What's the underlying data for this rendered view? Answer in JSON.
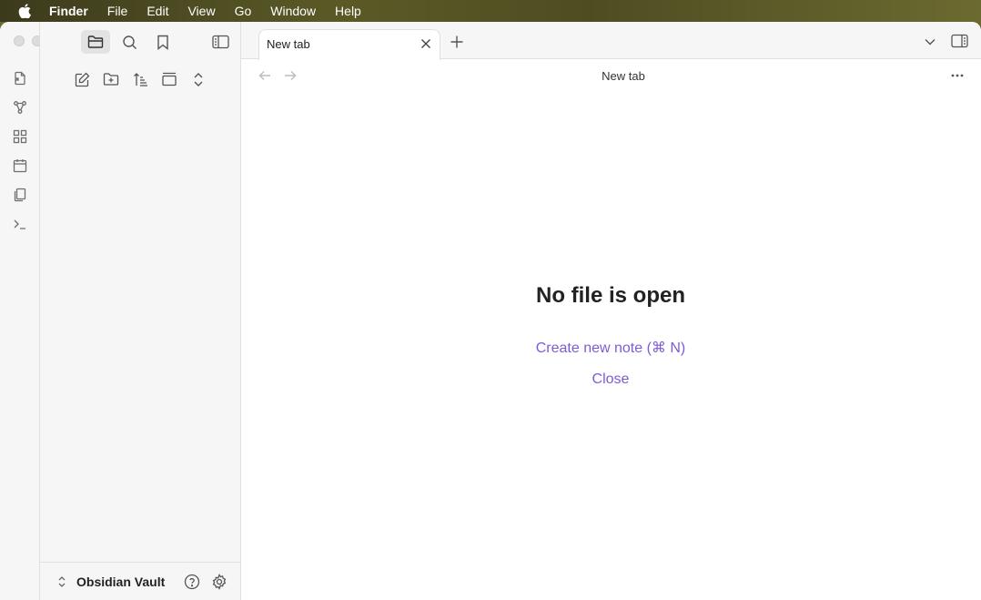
{
  "menubar": {
    "app_name": "Finder",
    "items": [
      "File",
      "Edit",
      "View",
      "Go",
      "Window",
      "Help"
    ]
  },
  "ribbon": {
    "icons": [
      "open-quick-switcher-icon",
      "graph-view-icon",
      "canvas-icon",
      "daily-note-icon",
      "templates-icon",
      "command-palette-icon"
    ]
  },
  "sidebar": {
    "tabs": [
      "files-icon",
      "search-icon",
      "bookmarks-icon"
    ],
    "actions": [
      "new-note-icon",
      "new-folder-icon",
      "sort-icon",
      "collapse-all-icon",
      "expand-icon"
    ],
    "vault_name": "Obsidian Vault"
  },
  "tabbar": {
    "tabs": [
      {
        "title": "New tab"
      }
    ]
  },
  "view": {
    "title": "New tab"
  },
  "empty_state": {
    "title": "No file is open",
    "create_label": "Create new note (⌘ N)",
    "close_label": "Close"
  },
  "colors": {
    "accent": "#7e5bd6",
    "sidebar_bg": "#f6f6f6",
    "border": "#e0e0e0"
  }
}
